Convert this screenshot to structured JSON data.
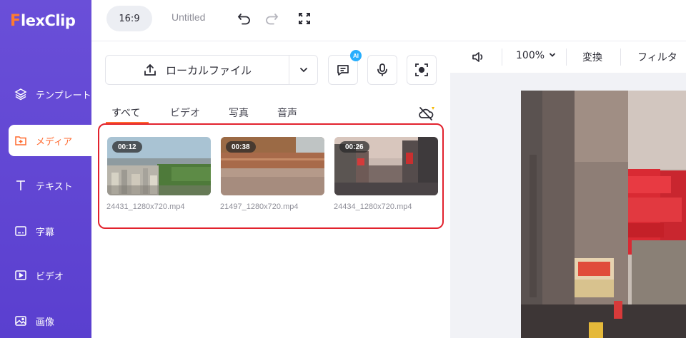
{
  "app": {
    "logo_first": "F",
    "logo_rest": "lexClip"
  },
  "sidebar": {
    "items": [
      {
        "label": "テンプレート",
        "icon": "layers-icon"
      },
      {
        "label": "メディア",
        "icon": "folder-add-icon",
        "active": true
      },
      {
        "label": "テキスト",
        "icon": "text-icon"
      },
      {
        "label": "字幕",
        "icon": "subtitle-icon"
      },
      {
        "label": "ビデオ",
        "icon": "video-icon"
      },
      {
        "label": "画像",
        "icon": "image-icon"
      }
    ]
  },
  "topbar": {
    "ratio": "16:9",
    "title": "Untitled",
    "icons": [
      "undo-icon",
      "redo-icon",
      "fullscreen-icon"
    ]
  },
  "media": {
    "upload_label": "ローカルファイル",
    "ai_badge": "AI",
    "tabs": [
      "すべて",
      "ビデオ",
      "写真",
      "音声"
    ],
    "items": [
      {
        "duration": "00:12",
        "filename": "24431_1280x720.mp4"
      },
      {
        "duration": "00:38",
        "filename": "21497_1280x720.mp4"
      },
      {
        "duration": "00:26",
        "filename": "24434_1280x720.mp4"
      }
    ]
  },
  "preview": {
    "zoom": "100%",
    "transform_label": "変換",
    "filter_label": "フィルタ"
  },
  "colors": {
    "sidebar": "#5a3fcf",
    "accent": "#ff6a2f",
    "highlight": "#e2222d",
    "ai_badge": "#27aefd"
  }
}
